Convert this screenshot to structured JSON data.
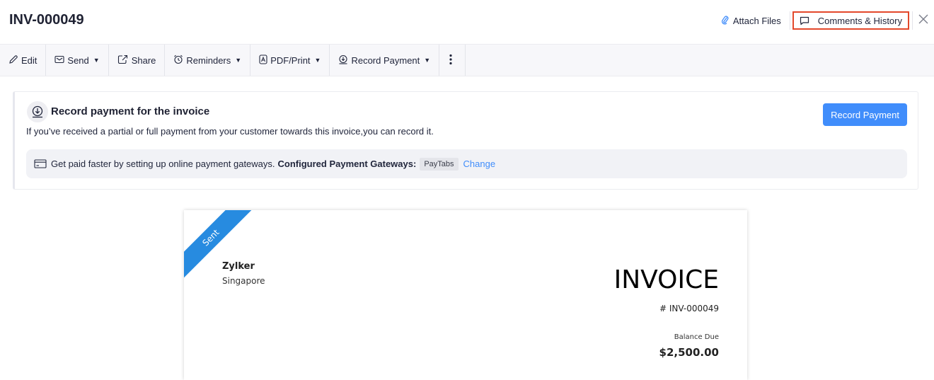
{
  "header": {
    "title": "INV-000049",
    "attach_label": "Attach Files",
    "comments_label": "Comments & History"
  },
  "toolbar": {
    "edit": "Edit",
    "send": "Send",
    "share": "Share",
    "reminders": "Reminders",
    "pdf_print": "PDF/Print",
    "record_payment": "Record Payment"
  },
  "banner": {
    "title": "Record payment for the invoice",
    "description": "If you’ve received a partial or full payment from your customer towards this invoice,you can record it.",
    "button_label": "Record Payment",
    "gateway_text": "Get paid faster by setting up online payment gateways.",
    "gateway_label": "Configured Payment Gateways:",
    "gateway_name": "PayTabs",
    "change_label": "Change"
  },
  "invoice": {
    "status": "Sent",
    "organization": "Zylker",
    "location": "Singapore",
    "heading": "INVOICE",
    "number": "# INV-000049",
    "balance_label": "Balance Due",
    "balance_value": "$2,500.00"
  },
  "colors": {
    "accent": "#408dfb",
    "ribbon": "#278be0",
    "highlight_border": "#e3482b"
  }
}
